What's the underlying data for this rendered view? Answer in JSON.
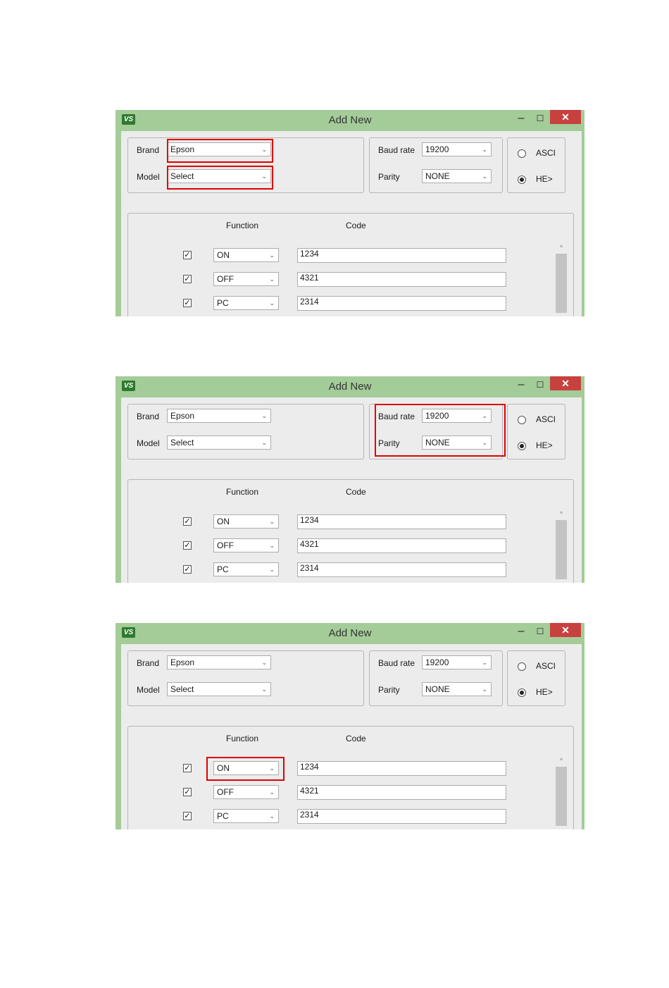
{
  "window": {
    "title": "Add New",
    "app_icon": "VS",
    "minimize_glyph": "–",
    "maximize_glyph": "☐",
    "close_glyph": "✕",
    "titlebar_color": "#a4cc98",
    "close_color": "#c7413f"
  },
  "device": {
    "brand_label": "Brand",
    "brand_value": "Epson",
    "model_label": "Model",
    "model_value": "Select"
  },
  "serial": {
    "baud_label": "Baud rate",
    "baud_value": "19200",
    "parity_label": "Parity",
    "parity_value": "NONE"
  },
  "mode": {
    "ascii_label": "ASCI",
    "hex_label": "HE>",
    "selected": "hex"
  },
  "functions": {
    "function_header": "Function",
    "code_header": "Code",
    "rows": [
      {
        "checked": true,
        "function": "ON",
        "code": "1234"
      },
      {
        "checked": true,
        "function": "OFF",
        "code": "4321"
      },
      {
        "checked": true,
        "function": "PC",
        "code": "2314"
      }
    ]
  },
  "glyphs": {
    "check": "✓",
    "chevron": "⌄",
    "scroll_up": "^"
  },
  "highlight_color": "#e00000"
}
